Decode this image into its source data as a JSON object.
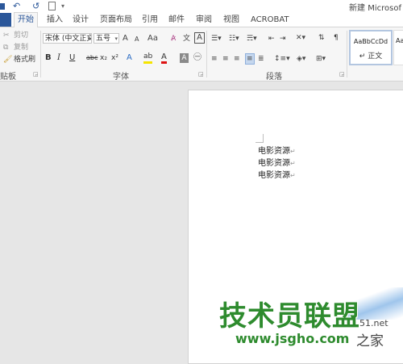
{
  "titlebar": {
    "document_title": "新建 Microsof",
    "qat_undo": "↶",
    "qat_redo": "↺",
    "qat_more": "▾"
  },
  "tabs": [
    {
      "label": "开始",
      "active": true
    },
    {
      "label": "插入"
    },
    {
      "label": "设计"
    },
    {
      "label": "页面布局"
    },
    {
      "label": "引用"
    },
    {
      "label": "邮件"
    },
    {
      "label": "审阅"
    },
    {
      "label": "视图"
    },
    {
      "label": "ACROBAT"
    }
  ],
  "clipboard": {
    "cut": "剪切",
    "copy": "复制",
    "format_painter": "格式刷",
    "group_label": "贴板"
  },
  "font": {
    "font_name": "宋体 (中文正文",
    "font_size": "五号",
    "grow": "A",
    "shrink": "A",
    "change_case": "Aa",
    "bold": "B",
    "italic": "I",
    "underline": "U",
    "strike": "abc",
    "subscript": "x₂",
    "superscript": "x²",
    "font_color_glyph": "A",
    "group_label": "字体"
  },
  "paragraph": {
    "group_label": "段落"
  },
  "styles": {
    "normal_preview": "AaBbCcDd",
    "normal_label": "正文",
    "next_preview": "AaBb"
  },
  "document": {
    "lines": [
      "电影资源",
      "电影资源",
      "电影资源"
    ],
    "para_mark": "↵"
  },
  "watermark": {
    "brand_cn": "技术员联盟",
    "url": "www.jsgho.com",
    "tail_top": "51.net",
    "tail_bottom": "之家"
  },
  "colors": {
    "accent": "#2b579a",
    "watermark_green": "#2e8b2e"
  }
}
